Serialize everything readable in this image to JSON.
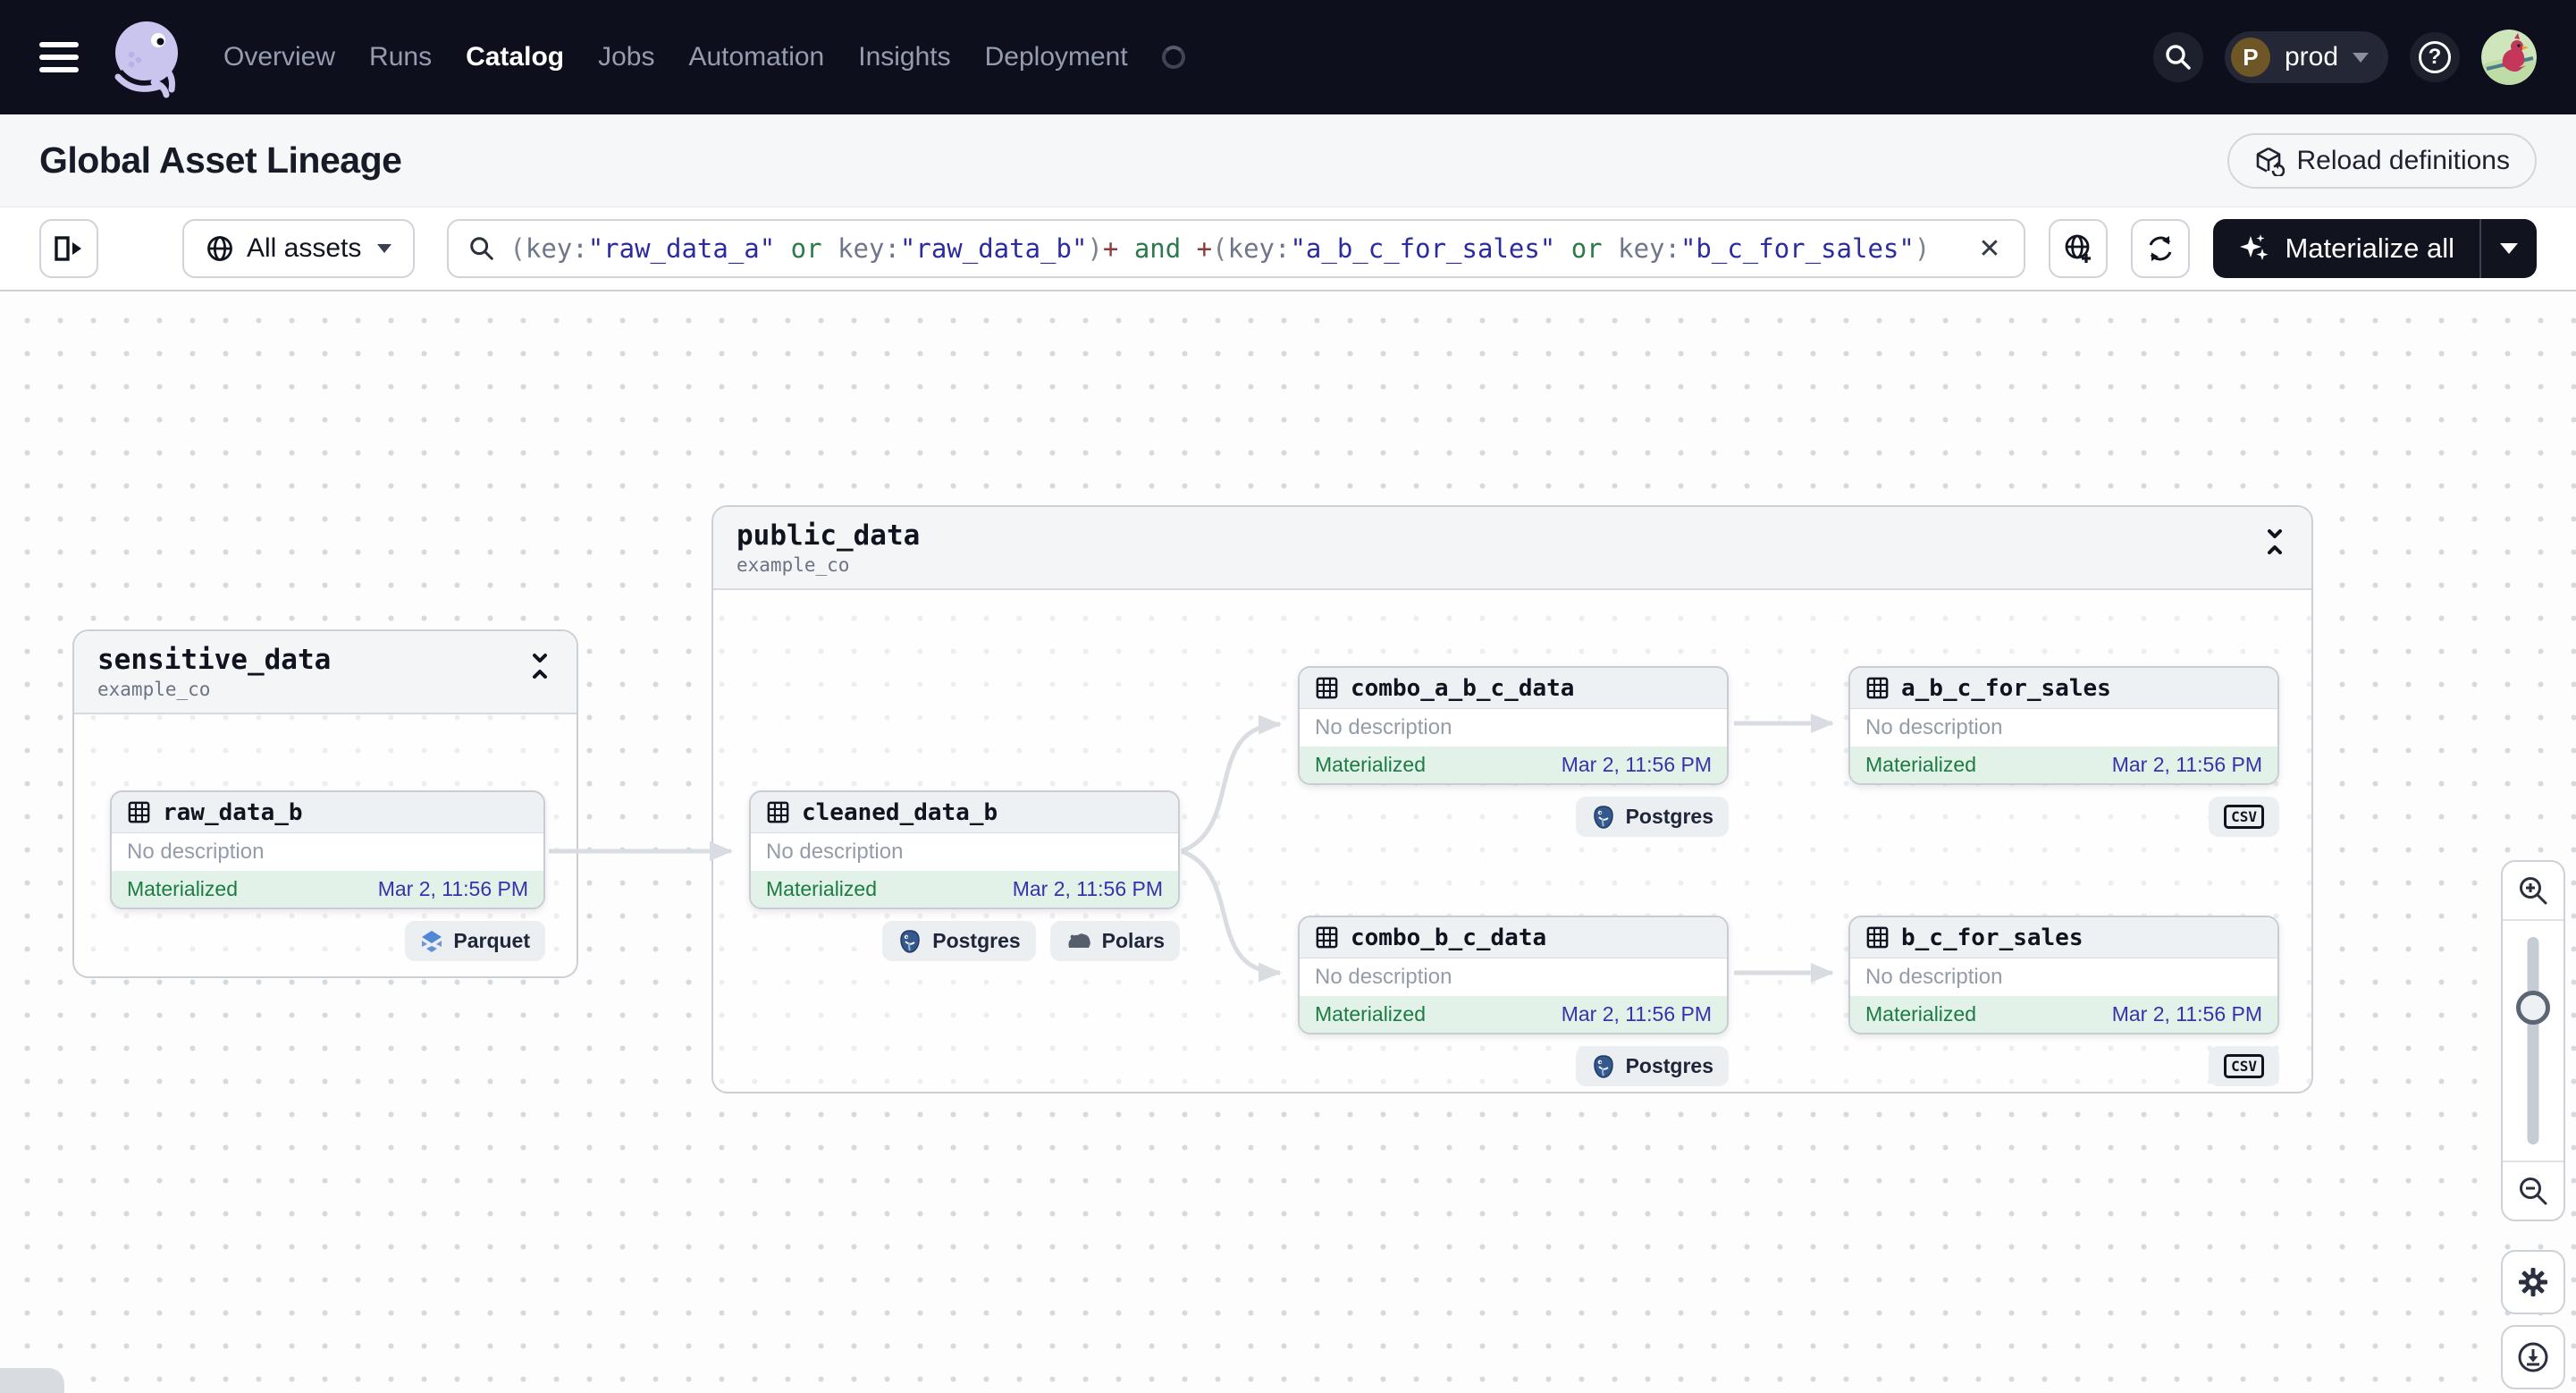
{
  "nav": {
    "items": [
      {
        "label": "Overview",
        "active": false
      },
      {
        "label": "Runs",
        "active": false
      },
      {
        "label": "Catalog",
        "active": true
      },
      {
        "label": "Jobs",
        "active": false
      },
      {
        "label": "Automation",
        "active": false
      },
      {
        "label": "Insights",
        "active": false
      },
      {
        "label": "Deployment",
        "active": false
      }
    ],
    "environment": {
      "initial": "P",
      "name": "prod"
    }
  },
  "header": {
    "title": "Global Asset Lineage",
    "reload_label": "Reload definitions"
  },
  "toolbar": {
    "scope_label": "All assets",
    "materialize_label": "Materialize all",
    "clear_label": "✕",
    "query": {
      "segments": [
        {
          "text": "("
        },
        {
          "text": "key:"
        },
        {
          "text": "\"raw_data_a\""
        },
        {
          "text": " or "
        },
        {
          "text": "key:"
        },
        {
          "text": "\"raw_data_b\""
        },
        {
          "text": ")"
        },
        {
          "text": "+"
        },
        {
          "text": " and "
        },
        {
          "text": "+"
        },
        {
          "text": "("
        },
        {
          "text": "key:"
        },
        {
          "text": "\"a_b_c_for_sales\""
        },
        {
          "text": " or "
        },
        {
          "text": "key:"
        },
        {
          "text": "\"b_c_for_sales\""
        },
        {
          "text": ")"
        }
      ]
    }
  },
  "graph": {
    "groups": [
      {
        "name": "sensitive_data",
        "repo": "example_co"
      },
      {
        "name": "public_data",
        "repo": "example_co"
      }
    ],
    "nodes": [
      {
        "name": "raw_data_b",
        "description": "No description",
        "status": "Materialized",
        "date": "Mar 2, 11:56 PM",
        "badges": [
          {
            "label": "Parquet",
            "icon": "parquet-icon"
          }
        ]
      },
      {
        "name": "cleaned_data_b",
        "description": "No description",
        "status": "Materialized",
        "date": "Mar 2, 11:56 PM",
        "badges": [
          {
            "label": "Postgres",
            "icon": "postgres-icon"
          },
          {
            "label": "Polars",
            "icon": "polars-icon"
          }
        ]
      },
      {
        "name": "combo_a_b_c_data",
        "description": "No description",
        "status": "Materialized",
        "date": "Mar 2, 11:56 PM",
        "badges": [
          {
            "label": "Postgres",
            "icon": "postgres-icon"
          }
        ]
      },
      {
        "name": "a_b_c_for_sales",
        "description": "No description",
        "status": "Materialized",
        "date": "Mar 2, 11:56 PM",
        "badges": [
          {
            "label": "CSV",
            "icon": "csv-icon"
          }
        ]
      },
      {
        "name": "combo_b_c_data",
        "description": "No description",
        "status": "Materialized",
        "date": "Mar 2, 11:56 PM",
        "badges": [
          {
            "label": "Postgres",
            "icon": "postgres-icon"
          }
        ]
      },
      {
        "name": "b_c_for_sales",
        "description": "No description",
        "status": "Materialized",
        "date": "Mar 2, 11:56 PM",
        "badges": [
          {
            "label": "CSV",
            "icon": "csv-icon"
          }
        ]
      }
    ]
  },
  "icons": {
    "logo": "dagster-octopus",
    "search": "magnifier",
    "help": "question-circle",
    "materialize": "sparkles",
    "collapse": "chevrons-inward",
    "asset": "table-grid",
    "zoom_in": "magnifier-plus",
    "zoom_out": "magnifier-minus",
    "settings": "gear",
    "export": "download-circle"
  },
  "colors": {
    "topbar": "#0d0f1d",
    "accent_green": "#1c7c44",
    "status_bg": "#e2f2e8",
    "date_indigo": "#3733aa",
    "query_value": "#2d2c9f",
    "query_operator": "#2c7a4b",
    "edge": "#d9dce1"
  }
}
